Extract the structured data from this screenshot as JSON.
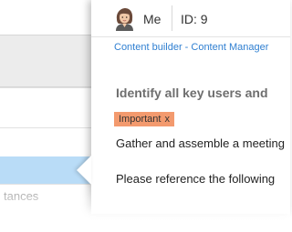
{
  "background_list": {
    "partial_text": "tances"
  },
  "header": {
    "user_label": "Me",
    "id_label": "ID: 9"
  },
  "breadcrumb": "Content builder - Content Manager",
  "task": {
    "title": "Identify all key users and",
    "tag": {
      "label": "Important",
      "remove": "x",
      "color": "#f39a6e"
    },
    "description_lines": [
      "Gather and assemble a meeting",
      "Please reference the following"
    ]
  },
  "colors": {
    "link": "#2f7fd1",
    "selected_row": "#b9dcf7"
  },
  "icons": {
    "avatar": "user-avatar-icon"
  }
}
